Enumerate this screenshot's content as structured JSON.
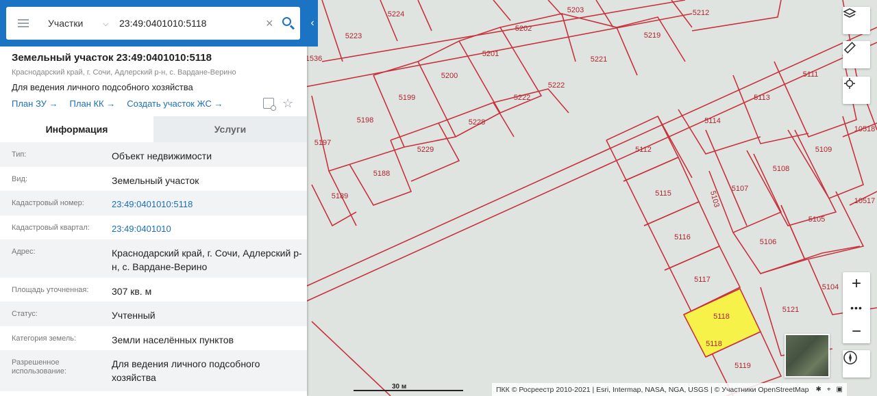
{
  "search": {
    "type_label": "Участки",
    "query": "23:49:0401010:5118"
  },
  "parcel": {
    "title": "Земельный участок 23:49:0401010:5118",
    "address_short": "Краснодарский край, г. Сочи, Адлерский р-н, с. Вардане-Верино",
    "use": "Для ведения личного подсобного хозяйства",
    "links": [
      "План ЗУ →",
      "План КК →",
      "Создать участок ЖС →"
    ]
  },
  "tabs": [
    {
      "label": "Информация",
      "active": true
    },
    {
      "label": "Услуги",
      "active": false
    }
  ],
  "info_rows": [
    {
      "label": "Тип:",
      "value": "Объект недвижимости"
    },
    {
      "label": "Вид:",
      "value": "Земельный участок"
    },
    {
      "label": "Кадастровый номер:",
      "value": "23:49:0401010:5118",
      "link": true
    },
    {
      "label": "Кадастровый квартал:",
      "value": "23:49:0401010",
      "link": true
    },
    {
      "label": "Адрес:",
      "value": "Краснодарский край, г. Сочи, Адлерский р-н, с. Вардане-Верино"
    },
    {
      "label": "Площадь уточненная:",
      "value": "307 кв. м"
    },
    {
      "label": "Статус:",
      "value": "Учтенный"
    },
    {
      "label": "Категория земель:",
      "value": "Земли населённых пунктов"
    },
    {
      "label": "Разрешенное использование:",
      "value": "Для ведения личного подсобного хозяйства"
    }
  ],
  "map": {
    "labels": [
      "5224",
      "5203",
      "5212",
      "1536",
      "5223",
      "5202",
      "5219",
      "5201",
      "5221",
      "5111",
      "5200",
      "5222",
      "5199",
      "5113",
      "5222",
      "5198",
      "5228",
      "5114",
      "10518",
      "5197",
      "5229",
      "5112",
      "5109",
      "5188",
      "5108",
      "5189",
      "5107",
      "5115",
      "10517",
      "5103",
      "5105",
      "5116",
      "5106",
      "5117",
      "5104",
      "5121",
      "5118",
      "5118",
      "5119"
    ],
    "selected_color": "#f6f24a",
    "parcel_line_color": "#c8323c",
    "scale_label": "30 м",
    "attribution": "ПКК © Росреестр 2010-2021 | Esri, Intermap, NASA, NGA, USGS | © Участники OpenStreetMap"
  }
}
